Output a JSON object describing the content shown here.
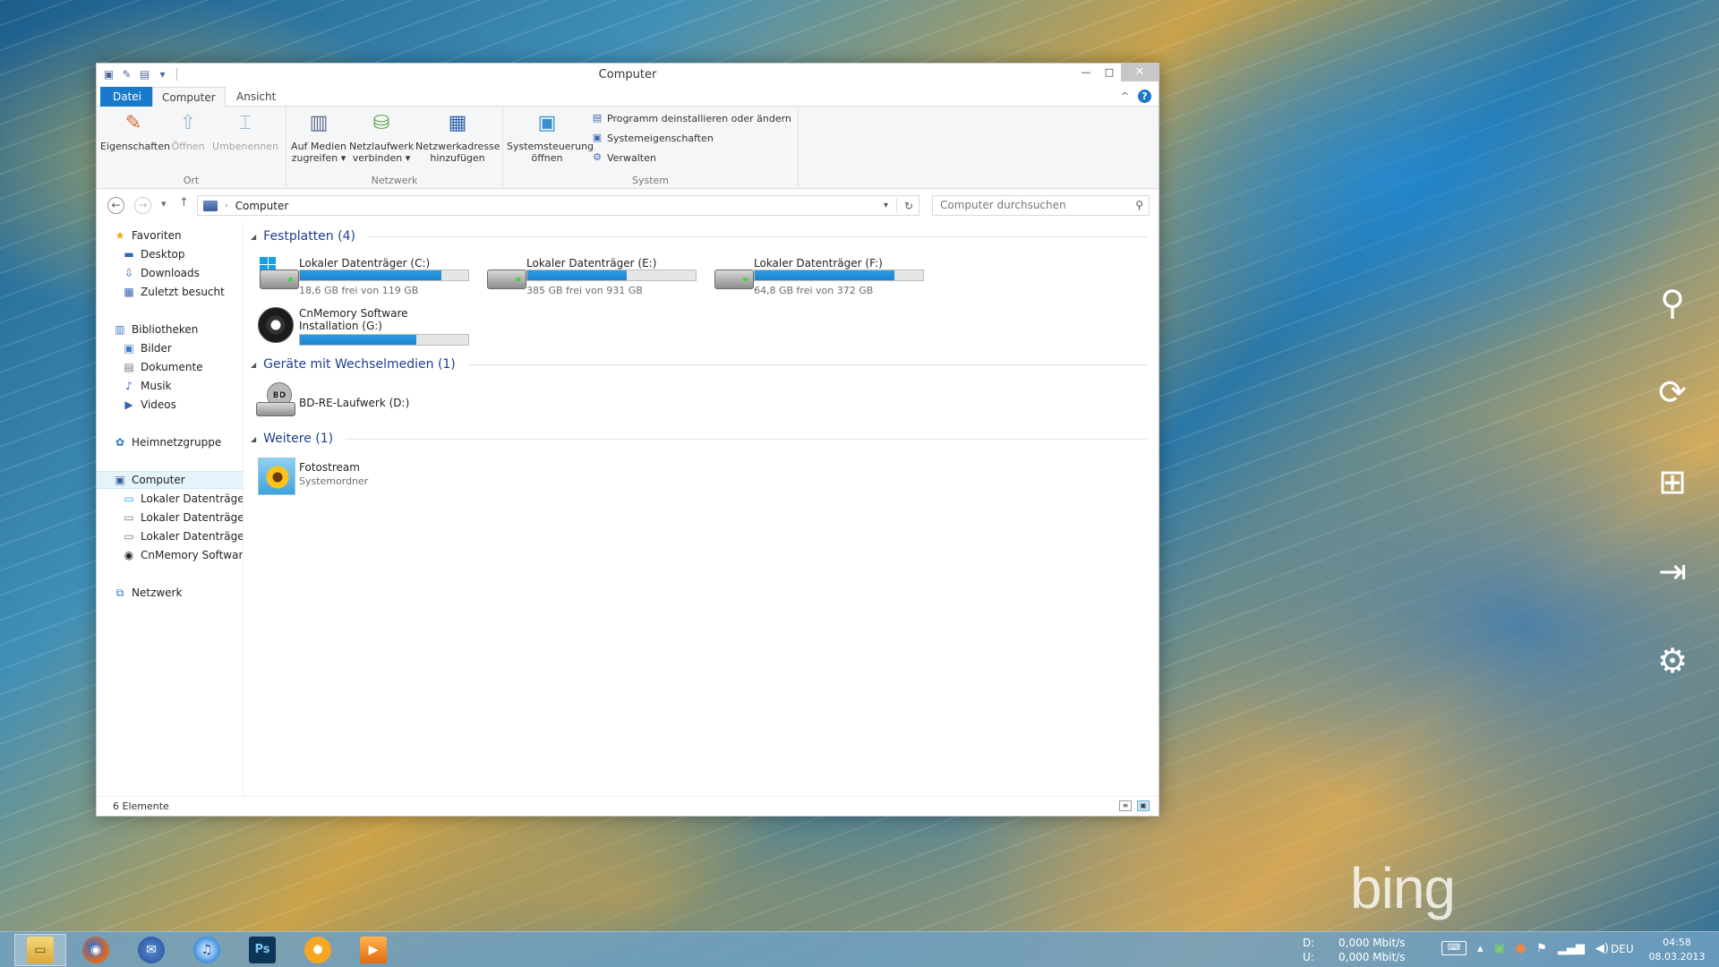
{
  "window": {
    "title": "Computer",
    "qat": {
      "properties": "✎",
      "new_folder": "▤",
      "dropdown": "▾"
    },
    "controls": {
      "minimize": "—",
      "maximize": "□",
      "close": "✕"
    }
  },
  "ribbon": {
    "tabs": {
      "file": "Datei",
      "computer": "Computer",
      "view": "Ansicht"
    },
    "collapse": "^",
    "help": "?",
    "groups": {
      "ort": {
        "label": "Ort",
        "properties": "Eigenschaften",
        "open": "Öffnen",
        "rename": "Umbenennen"
      },
      "netzwerk": {
        "label": "Netzwerk",
        "media_line1": "Auf Medien",
        "media_line2": "zugreifen ▾",
        "map_line1": "Netzlaufwerk",
        "map_line2": "verbinden ▾",
        "addr_line1": "Netzwerkadresse",
        "addr_line2": "hinzufügen"
      },
      "system": {
        "label": "System",
        "cp_line1": "Systemsteuerung",
        "cp_line2": "öffnen",
        "uninstall": "Programm deinstallieren oder ändern",
        "properties": "Systemeigenschaften",
        "manage": "Verwalten"
      }
    }
  },
  "address": {
    "crumb": "Computer",
    "search_placeholder": "Computer durchsuchen"
  },
  "navpane": {
    "favorites": "Favoriten",
    "desktop": "Desktop",
    "downloads": "Downloads",
    "recent": "Zuletzt besucht",
    "libraries": "Bibliotheken",
    "pictures": "Bilder",
    "documents": "Dokumente",
    "music": "Musik",
    "videos": "Videos",
    "homegroup": "Heimnetzgruppe",
    "computer": "Computer",
    "drive_c": "Lokaler Datenträger",
    "drive_e": "Lokaler Datenträger",
    "drive_f": "Lokaler Datenträger",
    "drive_g": "CnMemory Software",
    "network": "Netzwerk"
  },
  "groups": {
    "hdd": {
      "label": "Festplatten (4)"
    },
    "removable": {
      "label": "Geräte mit Wechselmedien (1)"
    },
    "other": {
      "label": "Weitere (1)"
    }
  },
  "drives": [
    {
      "name": "Lokaler Datenträger (C:)",
      "free": "18,6 GB frei von 119 GB",
      "used_fraction": 0.84
    },
    {
      "name": "Lokaler Datenträger (E:)",
      "free": "385 GB frei von 931 GB",
      "used_fraction": 0.59
    },
    {
      "name": "Lokaler Datenträger (F:)",
      "free": "64,8 GB frei von 372 GB",
      "used_fraction": 0.83
    },
    {
      "name": "CnMemory Software Installation (G:)",
      "free": "",
      "used_fraction": 0.69
    }
  ],
  "removable": {
    "name": "BD-RE-Laufwerk (D:)",
    "badge": "BD"
  },
  "other": {
    "name": "Fotostream",
    "sub": "Systemordner"
  },
  "status": {
    "count": "6 Elemente"
  },
  "taskbar": {
    "net": {
      "down_label": "D:",
      "down_value": "0,000 Mbit/s",
      "up_label": "U:",
      "up_value": "0,000 Mbit/s"
    },
    "photoshop": "Ps",
    "lang": "DEU",
    "time": "04:58",
    "date": "08.03.2013"
  },
  "wallpaper_logo": "bing",
  "colors": {
    "accent": "#1979ca",
    "bar_fill": "#2a9ce4",
    "group_header": "#1e3d8c"
  }
}
